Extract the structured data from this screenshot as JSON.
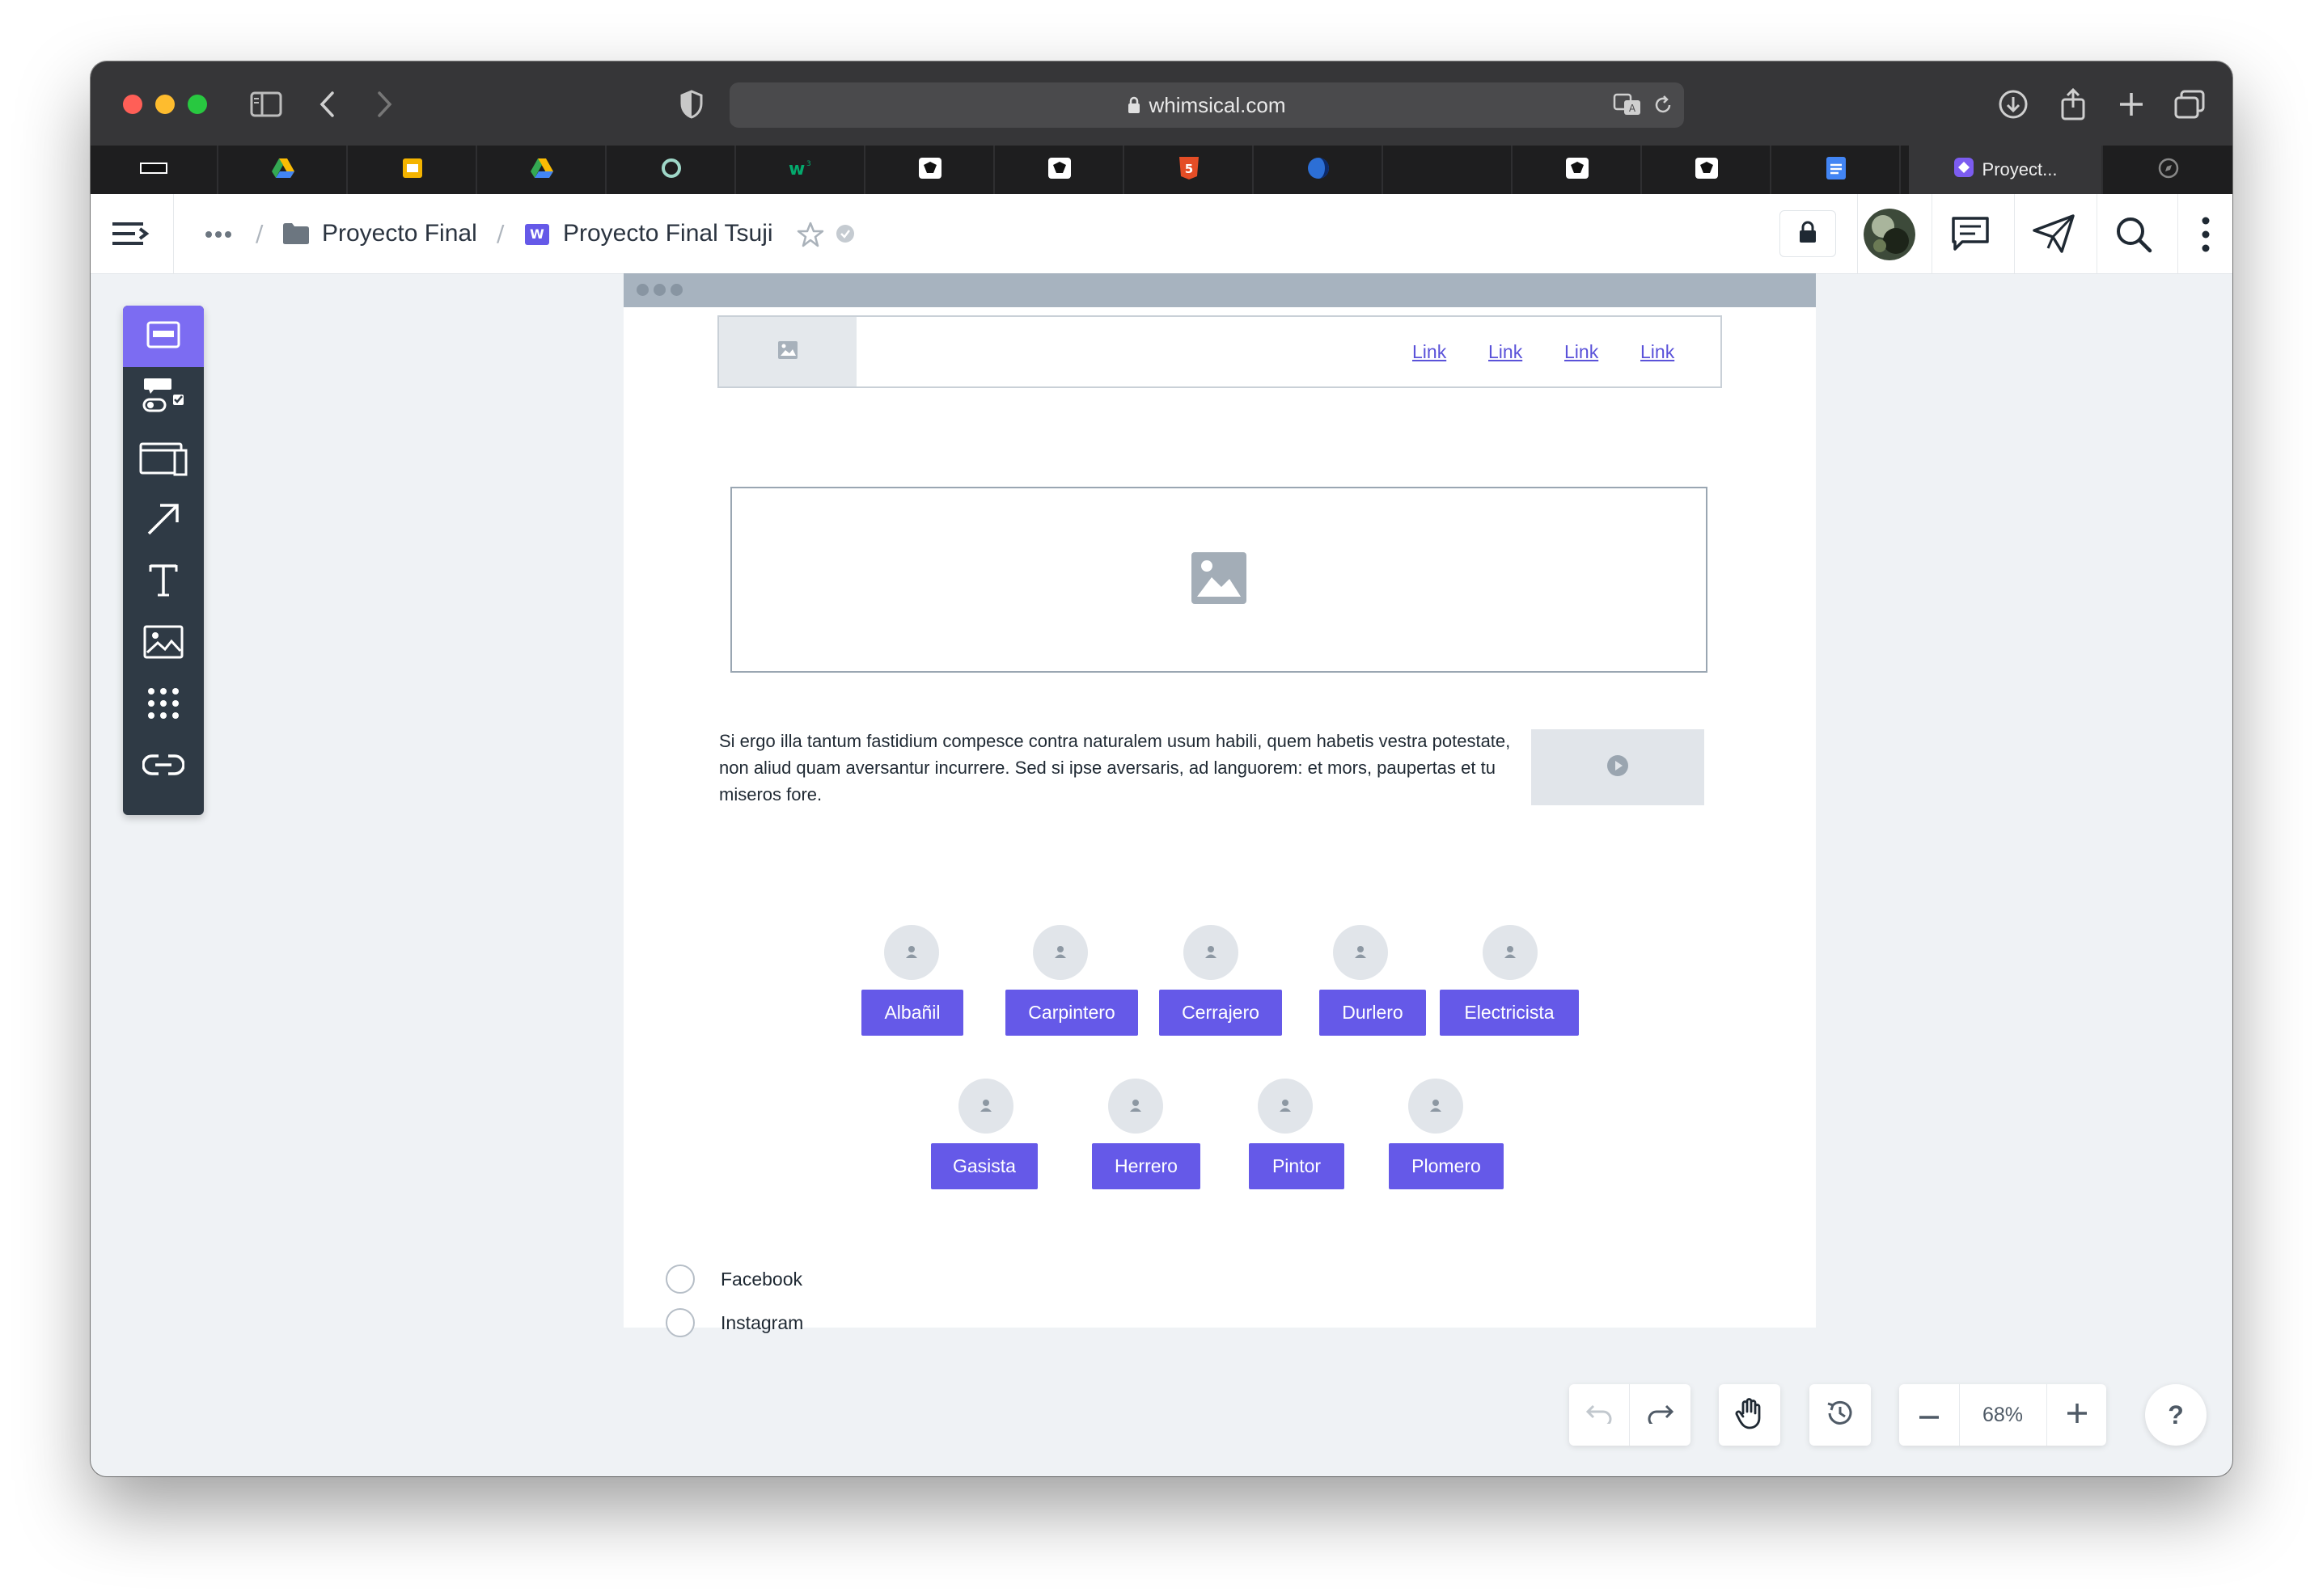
{
  "browser": {
    "url": "whimsical.com",
    "active_tab_title": "Proyect..."
  },
  "header": {
    "breadcrumb": [
      "Proyecto Final",
      "Proyecto Final Tsuji"
    ],
    "doc_badge": "W"
  },
  "toolbar": {
    "tools": [
      "wireframe-icon",
      "elements-icon",
      "window-icon",
      "arrow-icon",
      "text-icon",
      "image-icon",
      "grid-icon",
      "link-icon"
    ]
  },
  "wireframe": {
    "nav_links": [
      "Link",
      "Link",
      "Link",
      "Link"
    ],
    "paragraph": "Si ergo illa tantum fastidium compesce contra naturalem usum habili, quem habetis vestra potestate, non aliud quam aversantur incurrere. Sed si ipse aversaris, ad languorem: et mors, paupertas et tu miseros fore.",
    "trades_row1": [
      "Albañil",
      "Carpintero",
      "Cerrajero",
      "Durlero",
      "Electricista"
    ],
    "trades_row2": [
      "Gasista",
      "Herrero",
      "Pintor",
      "Plomero"
    ],
    "radios": [
      "Facebook",
      "Instagram"
    ]
  },
  "controls": {
    "zoom": "68%",
    "help": "?"
  },
  "colors": {
    "accent": "#6559e8",
    "toolbar_bg": "#2f3a45",
    "canvas_bg": "#eff2f5"
  }
}
